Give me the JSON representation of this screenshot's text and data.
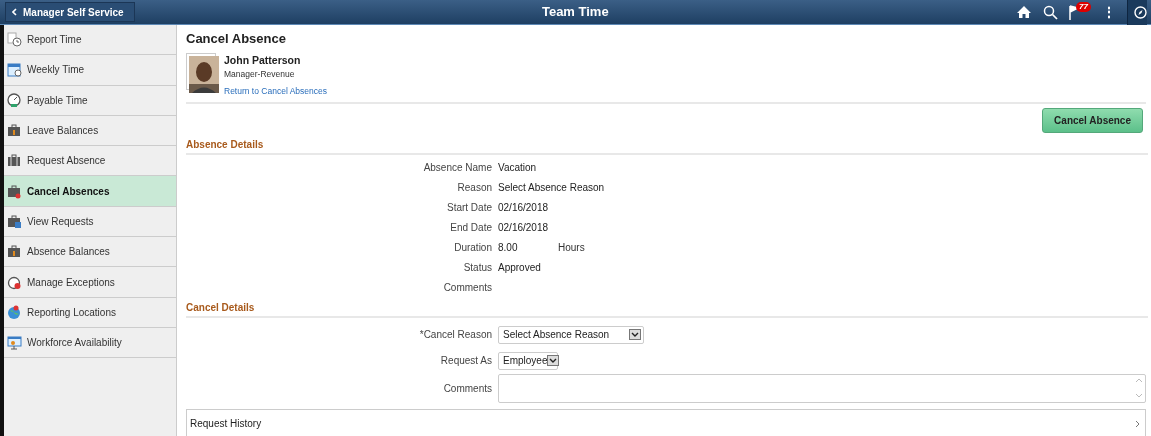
{
  "header": {
    "back_label": "Manager Self Service",
    "title": "Team Time",
    "notification_count": "77",
    "more": "⋮"
  },
  "sidebar": {
    "items": [
      {
        "label": "Report Time",
        "selected": false
      },
      {
        "label": "Weekly Time",
        "selected": false
      },
      {
        "label": "Payable Time",
        "selected": false
      },
      {
        "label": "Leave Balances",
        "selected": false
      },
      {
        "label": "Request Absence",
        "selected": false
      },
      {
        "label": "Cancel Absences",
        "selected": true
      },
      {
        "label": "View Requests",
        "selected": false
      },
      {
        "label": "Absence Balances",
        "selected": false
      },
      {
        "label": "Manage Exceptions",
        "selected": false
      },
      {
        "label": "Reporting Locations",
        "selected": false
      },
      {
        "label": "Workforce Availability",
        "selected": false
      }
    ]
  },
  "page": {
    "title": "Cancel Absence",
    "employee": {
      "name": "John Patterson",
      "role": "Manager-Revenue",
      "link": "Return to Cancel Absences"
    },
    "action_button": "Cancel Absence",
    "absence_details": {
      "heading": "Absence Details",
      "fields": [
        {
          "label": "Absence Name",
          "value": "Vacation"
        },
        {
          "label": "Reason",
          "value": "Select Absence Reason"
        },
        {
          "label": "Start Date",
          "value": "02/16/2018"
        },
        {
          "label": "End Date",
          "value": "02/16/2018"
        },
        {
          "label": "Duration",
          "value": "8.00",
          "unit": "Hours"
        },
        {
          "label": "Status",
          "value": "Approved"
        },
        {
          "label": "Comments"
        }
      ]
    },
    "cancel_details": {
      "heading": "Cancel Details",
      "cancel_reason": {
        "label": "*Cancel Reason",
        "value": "Select Absence Reason"
      },
      "request_as": {
        "label": "Request As",
        "value": "Employee"
      },
      "comments": {
        "label": "Comments"
      }
    },
    "request_history": "Request History"
  }
}
